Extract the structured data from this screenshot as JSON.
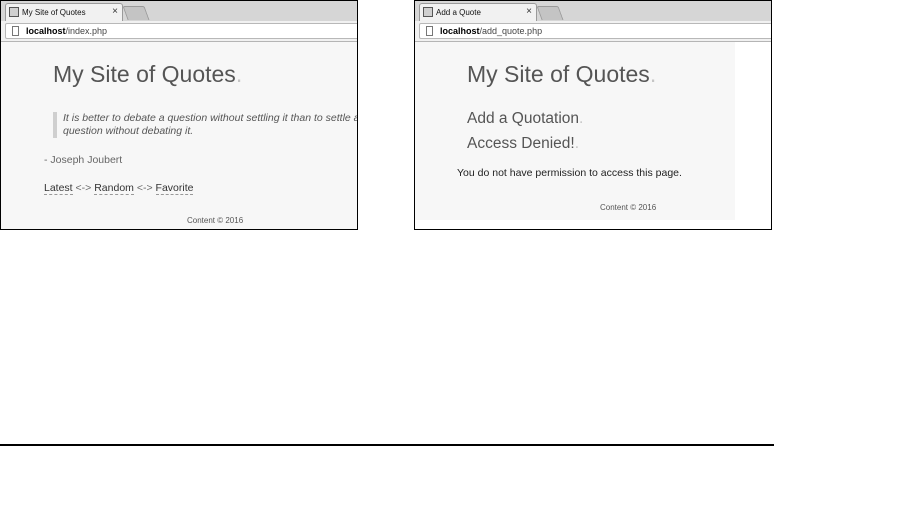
{
  "left_window": {
    "tab_title": "My Site of Quotes",
    "tab_close": "×",
    "url_host": "localhost",
    "url_path": "/index.php",
    "site_title": "My Site of Quotes",
    "title_dot": ".",
    "quote": "It is better to debate a question without settling it than to settle a question without debating it.",
    "author": "- Joseph Joubert",
    "links": {
      "latest": "Latest",
      "sep1": " <-> ",
      "random": "Random",
      "sep2": " <-> ",
      "favorite": "Favorite"
    },
    "footer": "Content © 2016"
  },
  "right_window": {
    "tab_title": "Add a Quote",
    "tab_close": "×",
    "url_host": "localhost",
    "url_path": "/add_quote.php",
    "site_title": "My Site of Quotes",
    "title_dot": ".",
    "heading1": "Add a Quotation",
    "heading2": "Access Denied!",
    "heading_dot": ".",
    "message": "You do not have permission to access this page.",
    "footer": "Content © 2016"
  },
  "colors": {
    "page_background": "#f7f7f7",
    "title_text": "#555555",
    "title_dot": "#c5c5c5",
    "quote_bar": "#cfcfcf"
  },
  "icons": [
    "page-favicon",
    "close-icon",
    "new-tab-icon",
    "document-icon"
  ]
}
